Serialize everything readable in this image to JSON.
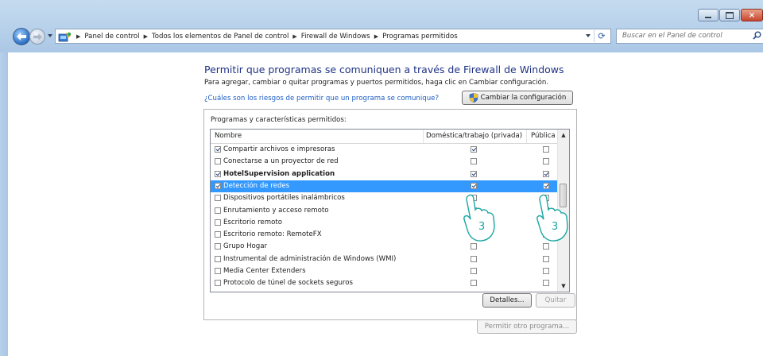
{
  "window": {
    "breadcrumbs": [
      "Panel de control",
      "Todos los elementos de Panel de control",
      "Firewall de Windows",
      "Programas permitidos"
    ],
    "search_placeholder": "Buscar en el Panel de control",
    "buttons": {
      "minimize": "minimize-icon",
      "maximize": "maximize-icon",
      "close": "×"
    }
  },
  "page": {
    "title": "Permitir que programas se comuniquen a través de Firewall de Windows",
    "subtitle": "Para agregar, cambiar o quitar programas y puertos permitidos, haga clic en Cambiar configuración.",
    "risk_link": "¿Cuáles son los riesgos de permitir que un programa se comunique?",
    "change_button": "Cambiar la configuración"
  },
  "programs": {
    "group_title": "Programas y características permitidos:",
    "columns": [
      "Nombre",
      "Doméstica/trabajo (privada)",
      "Pública"
    ],
    "rows": [
      {
        "name": "Compartir archivos e impresoras",
        "enabled": true,
        "private": true,
        "public": false,
        "bold": false,
        "selected": false
      },
      {
        "name": "Conectarse a un proyector de red",
        "enabled": false,
        "private": false,
        "public": false,
        "bold": false,
        "selected": false
      },
      {
        "name": "HotelSupervision application",
        "enabled": true,
        "private": true,
        "public": true,
        "bold": true,
        "selected": false
      },
      {
        "name": "Detección de redes",
        "enabled": true,
        "private": true,
        "public": true,
        "bold": false,
        "selected": true
      },
      {
        "name": "Dispositivos portátiles inalámbricos",
        "enabled": false,
        "private": false,
        "public": false,
        "bold": false,
        "selected": false
      },
      {
        "name": "Enrutamiento y acceso remoto",
        "enabled": false,
        "private": false,
        "public": false,
        "bold": false,
        "selected": false
      },
      {
        "name": "Escritorio remoto",
        "enabled": false,
        "private": false,
        "public": false,
        "bold": false,
        "selected": false
      },
      {
        "name": "Escritorio remoto: RemoteFX",
        "enabled": false,
        "private": false,
        "public": false,
        "bold": false,
        "selected": false
      },
      {
        "name": "Grupo Hogar",
        "enabled": false,
        "private": false,
        "public": false,
        "bold": false,
        "selected": false
      },
      {
        "name": "Instrumental de administración de Windows (WMI)",
        "enabled": false,
        "private": false,
        "public": false,
        "bold": false,
        "selected": false
      },
      {
        "name": "Media Center Extenders",
        "enabled": false,
        "private": false,
        "public": false,
        "bold": false,
        "selected": false
      },
      {
        "name": "Protocolo de túnel de sockets seguros",
        "enabled": false,
        "private": false,
        "public": false,
        "bold": false,
        "selected": false
      }
    ],
    "details_button": "Detalles...",
    "remove_button": "Quitar",
    "allow_other_button": "Permitir otro programa..."
  },
  "callouts": [
    {
      "label": "3"
    },
    {
      "label": "3"
    }
  ]
}
